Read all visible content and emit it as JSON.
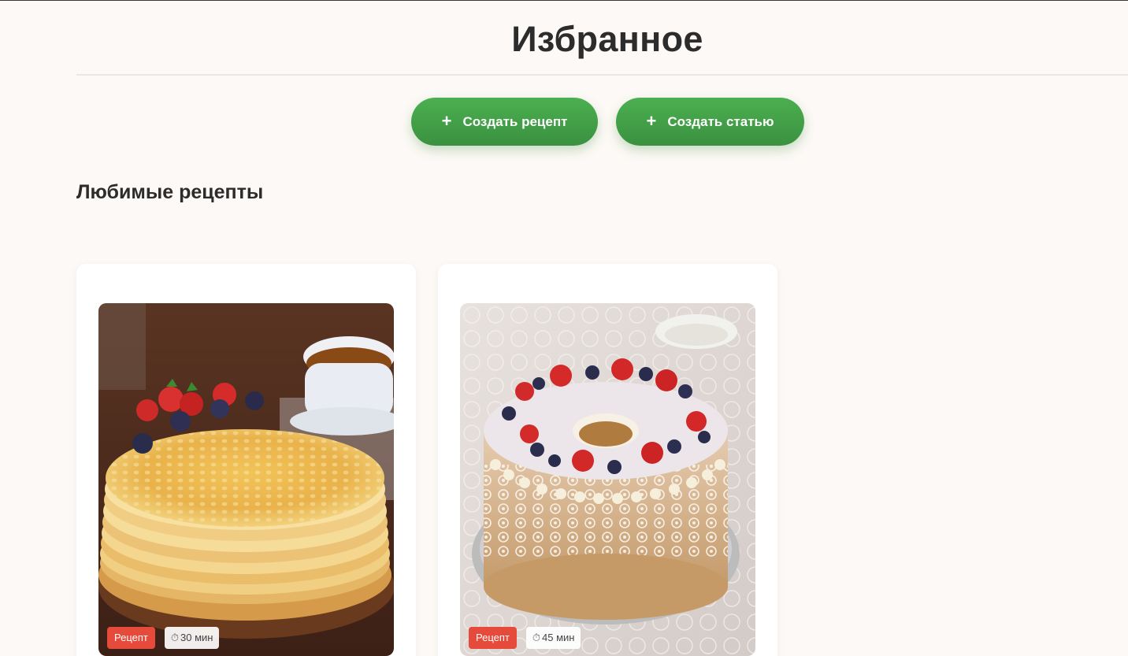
{
  "page": {
    "title": "Избранное"
  },
  "actions": {
    "create_recipe": {
      "icon": "plus-icon",
      "glyph": "+",
      "label": "Создать рецепт"
    },
    "create_article": {
      "icon": "plus-icon",
      "glyph": "+",
      "label": "Создать статью"
    }
  },
  "favorites": {
    "heading": "Любимые рецепты",
    "cards": [
      {
        "image": "pancakes-photo",
        "type_badge": "Рецепт",
        "time_icon": "stopwatch-icon",
        "time_glyph": "⏱",
        "time": "30 мин"
      },
      {
        "image": "cake-photo",
        "type_badge": "Рецепт",
        "time_icon": "stopwatch-icon",
        "time_glyph": "⏱",
        "time": "45 мин"
      }
    ]
  },
  "colors": {
    "background": "#fdf9f6",
    "button_green": "#43a047",
    "badge_red": "#e64a3a"
  }
}
